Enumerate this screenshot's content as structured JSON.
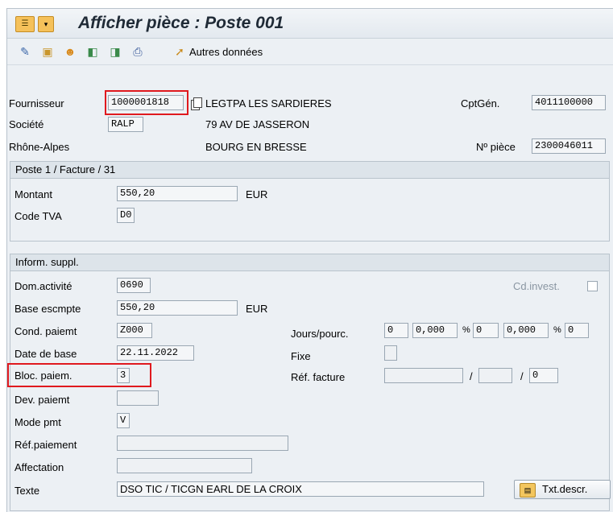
{
  "window": {
    "title": "Afficher pièce : Poste 001"
  },
  "toolbar": {
    "icons": [
      "edit-icon",
      "display-icon",
      "partner-icon",
      "previous-icon",
      "next-icon",
      "print-icon",
      "more-data-icon"
    ],
    "more_data_label": "Autres données"
  },
  "header": {
    "fournisseur_label": "Fournisseur",
    "fournisseur_value": "1000001818",
    "fournisseur_name": "LEGTPA LES SARDIERES",
    "cptgen_label": "CptGén.",
    "cptgen_value": "4011100000",
    "societe_label": "Société",
    "societe_value": "RALP",
    "address_street": "79 AV DE JASSERON",
    "region": "Rhône-Alpes",
    "address_city": "BOURG EN BRESSE",
    "piece_label": "Nº pièce",
    "piece_value": "2300046011"
  },
  "poste": {
    "title": "Poste 1 / Facture / 31",
    "montant_label": "Montant",
    "montant_value": "550,20",
    "montant_currency": "EUR",
    "tva_label": "Code TVA",
    "tva_value": "D0"
  },
  "inform": {
    "title": "Inform. suppl.",
    "dom_label": "Dom.activité",
    "dom_value": "0690",
    "cdinvest_label": "Cd.invest.",
    "base_label": "Base escmpte",
    "base_value": "550,20",
    "base_currency": "EUR",
    "cond_label": "Cond. paiemt",
    "cond_value": "Z000",
    "jours_label": "Jours/pourc.",
    "jours": [
      "0",
      "0,000",
      "%",
      "0",
      "0,000",
      "%",
      "0"
    ],
    "date_label": "Date de base",
    "date_value": "22.11.2022",
    "fixe_label": "Fixe",
    "bloc_label": "Bloc. paiem.",
    "bloc_value": "3",
    "ref_facture_label": "Réf. facture",
    "ref_sep1": "/",
    "ref_sep2": "/",
    "ref_last": "0",
    "dev_label": "Dev. paiemt",
    "mode_label": "Mode pmt",
    "mode_value": "V",
    "refpaie_label": "Réf.paiement",
    "affect_label": "Affectation",
    "texte_label": "Texte",
    "texte_value": "DSO TIC / TICGN EARL DE LA CROIX",
    "txt_descr_label": "Txt.descr."
  }
}
